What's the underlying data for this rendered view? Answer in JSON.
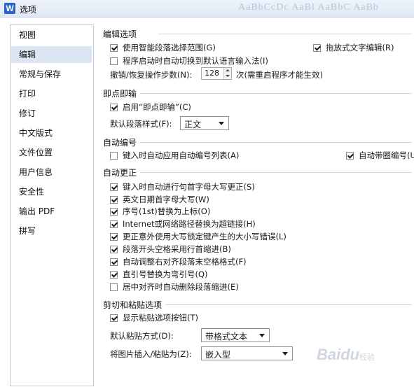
{
  "window": {
    "title": "选项",
    "app_icon_letter": "W",
    "ribbon_preview": "AaBbCcDc  AaBl  AaBbC  AaBb"
  },
  "sidebar": {
    "items": [
      {
        "label": "视图"
      },
      {
        "label": "编辑",
        "selected": true
      },
      {
        "label": "常规与保存"
      },
      {
        "label": "打印"
      },
      {
        "label": "修订"
      },
      {
        "label": "中文版式"
      },
      {
        "label": "文件位置"
      },
      {
        "label": "用户信息"
      },
      {
        "label": "安全性"
      },
      {
        "label": "输出 PDF"
      },
      {
        "label": "拼写"
      }
    ]
  },
  "editing": {
    "title": "编辑选项",
    "smart_selection": {
      "label": "使用智能段落选择范围(G)",
      "checked": true
    },
    "drag_drop": {
      "label": "拖放式文字编辑(R)",
      "checked": true
    },
    "auto_ime": {
      "label": "程序启动时自动切换到默认语言输入法(I)",
      "checked": false
    },
    "undo_label": "撤销/恢复操作步数(N):",
    "undo_value": "128",
    "undo_note": "次(需重启程序才能生效)"
  },
  "click_type": {
    "title": "即点即输",
    "enable": {
      "label": "启用“即点即输”(C)",
      "checked": true
    },
    "style_label": "默认段落样式(F):",
    "style_value": "正文"
  },
  "numbering": {
    "title": "自动编号",
    "auto_list": {
      "label": "键入时自动应用自动编号列表(A)",
      "checked": false
    },
    "circled": {
      "label": "自动带圈编号(U)",
      "checked": true
    }
  },
  "autocorrect": {
    "title": "自动更正",
    "options": [
      {
        "label": "键入时自动进行句首字母大写更正(S)",
        "checked": true
      },
      {
        "label": "英文日期首字母大写(W)",
        "checked": true
      },
      {
        "label": "序号(1st)替换为上标(O)",
        "checked": true
      },
      {
        "label": "Internet或网络路径替换为超链接(H)",
        "checked": true
      },
      {
        "label": "更正意外使用大写锁定键产生的大小写错误(L)",
        "checked": true
      },
      {
        "label": "段落开头空格采用行首缩进(B)",
        "checked": true
      },
      {
        "label": "自动调整右对齐段落末空格格式(F)",
        "checked": true
      },
      {
        "label": "直引号替换为弯引号(Q)",
        "checked": true
      },
      {
        "label": "居中对齐时自动删除段落缩进(E)",
        "checked": false
      }
    ]
  },
  "paste": {
    "title": "剪切和粘贴选项",
    "show_button": {
      "label": "显示粘贴选项按钮(T)",
      "checked": true
    },
    "default_label": "默认粘贴方式(D):",
    "default_value": "带格式文本",
    "image_label": "将图片插入/粘贴为(Z):",
    "image_value": "嵌入型"
  },
  "watermark": {
    "text": "Baidu",
    "sub": "经验"
  }
}
